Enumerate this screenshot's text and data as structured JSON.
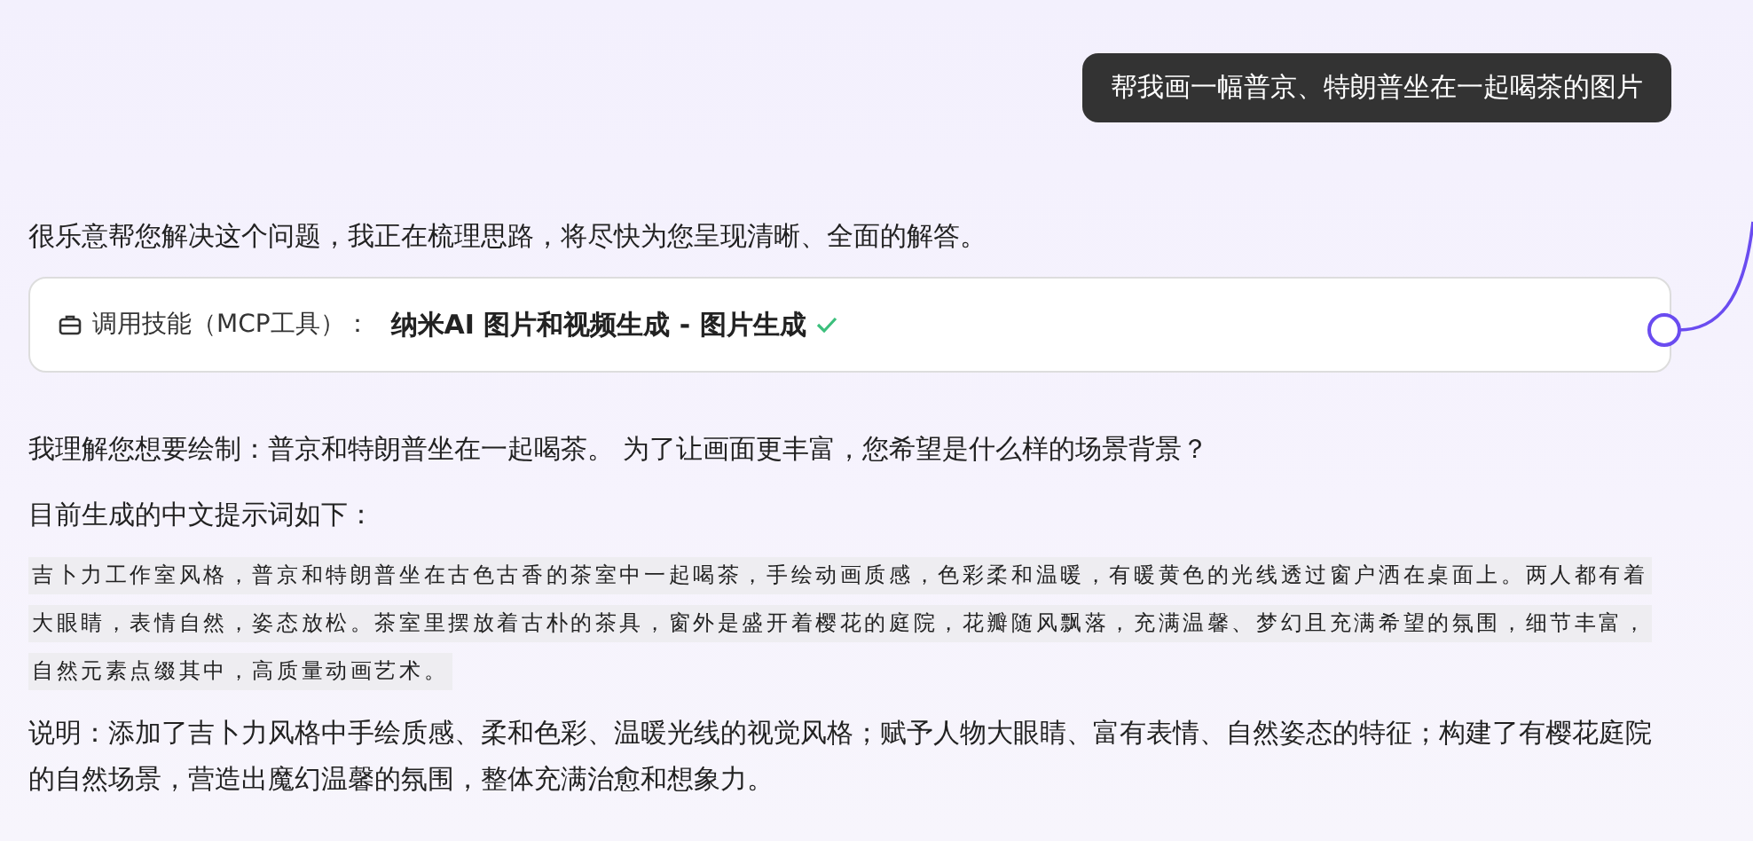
{
  "user_message": "帮我画一幅普京、特朗普坐在一起喝茶的图片",
  "assistant": {
    "intro": "很乐意帮您解决这个问题，我正在梳理思路，将尽快为您呈现清晰、全面的解答。",
    "tool_call": {
      "label": "调用技能（MCP工具）：",
      "name": "纳米AI 图片和视频生成 - 图片生成",
      "done": true
    },
    "blocks": [
      {
        "kind": "paragraph",
        "text": "我理解您想要绘制：普京和特朗普坐在一起喝茶。 为了让画面更丰富，您希望是什么样的场景背景？"
      },
      {
        "kind": "paragraph",
        "text": "目前生成的中文提示词如下："
      },
      {
        "kind": "prompt",
        "lines": [
          "吉卜力工作室风格，普京和特朗普坐在古色古香的茶室中一起喝茶，手绘动画质感，色彩柔和温暖，有暖黄色的光线透过窗户洒在桌面上。两人都有着",
          "大眼睛，表情自然，姿态放松。茶室里摆放着古朴的茶具，窗外是盛开着樱花的庭院，花瓣随风飘落，充满温馨、梦幻且充满希望的氛围，细节丰富，",
          "自然元素点缀其中，高质量动画艺术。"
        ]
      },
      {
        "kind": "paragraph",
        "text": "说明：添加了吉卜力风格中手绘质感、柔和色彩、温暖光线的视觉风格；赋予人物大眼睛、富有表情、自然姿态的特征；构建了有樱花庭院的自然场景，营造出魔幻温馨的氛围，整体充满治愈和想象力。"
      }
    ]
  }
}
